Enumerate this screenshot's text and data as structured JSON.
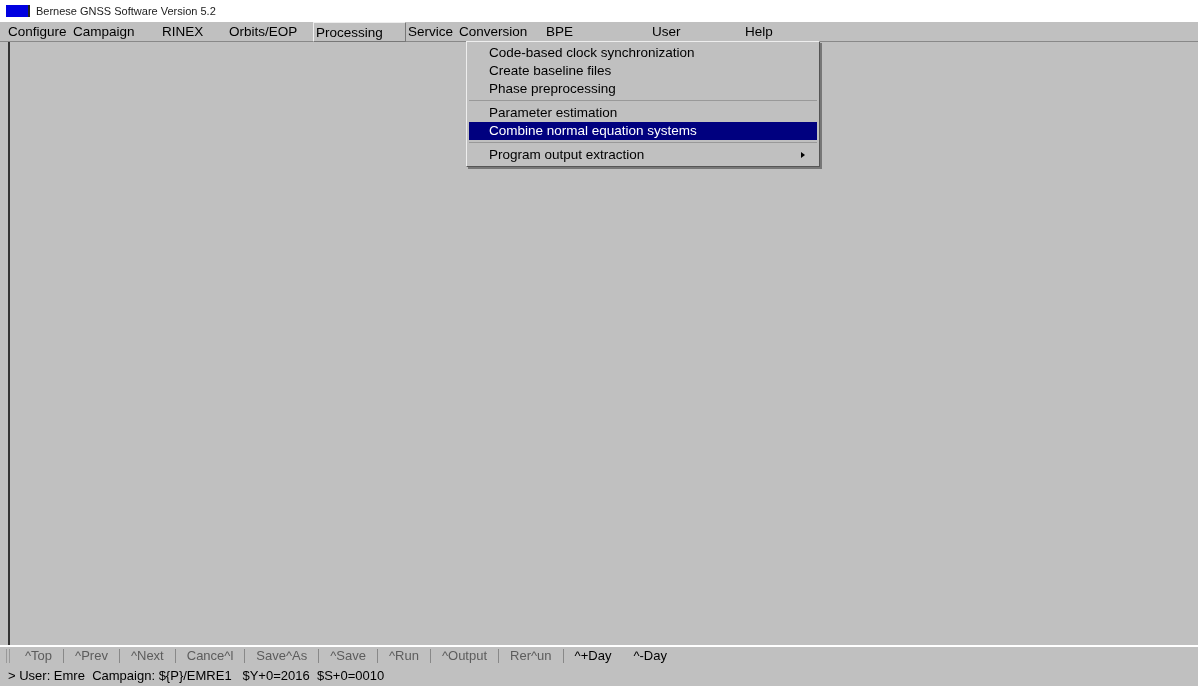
{
  "window": {
    "title": "Bernese GNSS Software Version 5.2"
  },
  "menu_bar": [
    {
      "label": "Configure",
      "selected": false
    },
    {
      "label": "Campaign",
      "selected": false
    },
    {
      "label": "RINEX",
      "selected": false
    },
    {
      "label": "Orbits/EOP",
      "selected": false
    },
    {
      "label": "Processing",
      "selected": true
    },
    {
      "label": "Service",
      "selected": false
    },
    {
      "label": "Conversion",
      "selected": false
    },
    {
      "label": "BPE",
      "selected": false
    },
    {
      "label": "User",
      "selected": false
    },
    {
      "label": "Help",
      "selected": false
    }
  ],
  "dropdown": {
    "items": [
      {
        "kind": "item",
        "label": "Code-based clock synchronization",
        "selected": false,
        "has_submenu": false
      },
      {
        "kind": "item",
        "label": "Create baseline files",
        "selected": false,
        "has_submenu": false
      },
      {
        "kind": "item",
        "label": "Phase preprocessing",
        "selected": false,
        "has_submenu": false
      },
      {
        "kind": "separator"
      },
      {
        "kind": "item",
        "label": "Parameter estimation",
        "selected": false,
        "has_submenu": false
      },
      {
        "kind": "item",
        "label": "Combine normal equation systems",
        "selected": true,
        "has_submenu": false
      },
      {
        "kind": "separator"
      },
      {
        "kind": "item",
        "label": "Program output extraction",
        "selected": false,
        "has_submenu": true
      }
    ]
  },
  "toolbar": [
    {
      "label": "^Top",
      "disabled": true
    },
    {
      "label": "^Prev",
      "disabled": true
    },
    {
      "label": "^Next",
      "disabled": true
    },
    {
      "label": "Cance^l",
      "disabled": true
    },
    {
      "label": "Save^As",
      "disabled": true
    },
    {
      "label": "^Save",
      "disabled": true
    },
    {
      "label": "^Run",
      "disabled": true
    },
    {
      "label": "^Output",
      "disabled": true
    },
    {
      "label": "Rer^un",
      "disabled": true
    },
    {
      "label": "^+Day",
      "disabled": false
    },
    {
      "label": "^-Day",
      "disabled": false
    }
  ],
  "status_bar": "> User: Emre  Campaign: ${P}/EMRE1   $Y+0=2016  $S+0=0010"
}
